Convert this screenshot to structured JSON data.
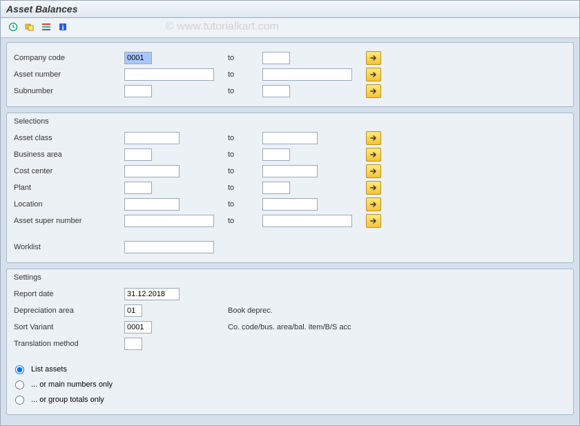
{
  "title": "Asset Balances",
  "watermark": "© www.tutorialkart.com",
  "toolbar": {
    "execute": "execute-icon",
    "variant": "variant-icon",
    "layout": "layout-icon",
    "info": "info-icon"
  },
  "top_block": {
    "rows": [
      {
        "label": "Company code",
        "from": "0001",
        "from_selected": true,
        "from_w": "w-short",
        "to_label": "to",
        "to": "",
        "to_w": "w-short",
        "multi": true
      },
      {
        "label": "Asset number",
        "from": "",
        "from_w": "w-long",
        "to_label": "to",
        "to": "",
        "to_w": "w-long",
        "multi": true
      },
      {
        "label": "Subnumber",
        "from": "",
        "from_w": "w-short",
        "to_label": "to",
        "to": "",
        "to_w": "w-short",
        "multi": true
      }
    ]
  },
  "selections": {
    "title": "Selections",
    "rows": [
      {
        "label": "Asset class",
        "from": "",
        "from_w": "w-mid",
        "to_label": "to",
        "to": "",
        "to_w": "w-mid",
        "multi": true
      },
      {
        "label": "Business area",
        "from": "",
        "from_w": "w-short",
        "to_label": "to",
        "to": "",
        "to_w": "w-short",
        "multi": true
      },
      {
        "label": "Cost center",
        "from": "",
        "from_w": "w-mid",
        "to_label": "to",
        "to": "",
        "to_w": "w-mid",
        "multi": true
      },
      {
        "label": "Plant",
        "from": "",
        "from_w": "w-short",
        "to_label": "to",
        "to": "",
        "to_w": "w-short",
        "multi": true
      },
      {
        "label": "Location",
        "from": "",
        "from_w": "w-mid",
        "to_label": "to",
        "to": "",
        "to_w": "w-mid",
        "multi": true
      },
      {
        "label": "Asset super number",
        "from": "",
        "from_w": "w-long",
        "to_label": "to",
        "to": "",
        "to_w": "w-long",
        "multi": true
      }
    ],
    "worklist": {
      "label": "Worklist",
      "value": ""
    }
  },
  "settings": {
    "title": "Settings",
    "rows": [
      {
        "label": "Report date",
        "value": "31.12.2018",
        "w": "w-mid",
        "desc": ""
      },
      {
        "label": "Depreciation area",
        "value": "01",
        "w": "w-vshort",
        "desc": "Book deprec."
      },
      {
        "label": "Sort Variant",
        "value": "0001",
        "w": "w-short",
        "desc": "Co. code/bus. area/bal. item/B/S acc"
      },
      {
        "label": "Translation method",
        "value": "",
        "w": "w-vshort",
        "desc": ""
      }
    ],
    "radios": [
      {
        "label": "List assets",
        "checked": true
      },
      {
        "label": "... or main numbers only",
        "checked": false
      },
      {
        "label": "... or group totals only",
        "checked": false
      }
    ]
  }
}
